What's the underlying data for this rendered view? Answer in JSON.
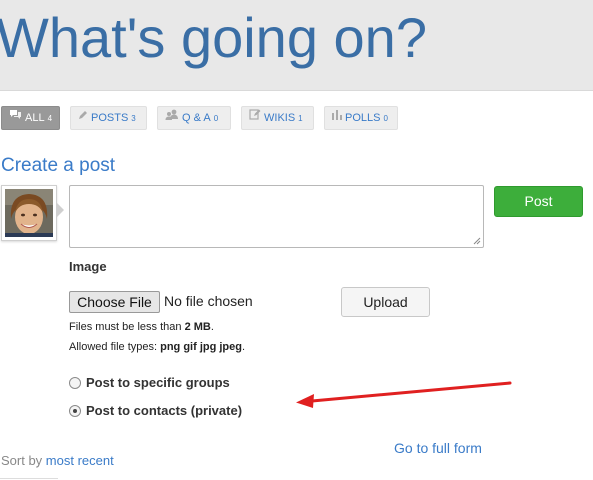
{
  "header": {
    "title": "What's going on?"
  },
  "tabs": [
    {
      "label": "ALL",
      "count": "4",
      "icon": "comments-icon",
      "active": true
    },
    {
      "label": "POSTS",
      "count": "3",
      "icon": "pencil-icon",
      "active": false
    },
    {
      "label": "Q & A",
      "count": "0",
      "icon": "users-icon",
      "active": false
    },
    {
      "label": "WIKIS",
      "count": "1",
      "icon": "edit-icon",
      "active": false
    },
    {
      "label": "POLLS",
      "count": "0",
      "icon": "bar-chart-icon",
      "active": false
    }
  ],
  "create_post": {
    "title": "Create a post",
    "textarea_value": "",
    "post_label": "Post",
    "image_label": "Image",
    "choose_file_label": "Choose File",
    "no_file_text": "No file chosen",
    "upload_label": "Upload",
    "size_text": "Files must be less than ",
    "size_value": "2 MB",
    "size_suffix": ".",
    "types_text": "Allowed file types: ",
    "types_value": "png gif jpg jpeg",
    "types_suffix": ".",
    "radio_groups_label": "Post to specific groups",
    "radio_contacts_label": "Post to contacts (private)",
    "selected_option": "contacts",
    "full_form_link": "Go to full form"
  },
  "sort": {
    "label": "Sort by ",
    "value": "most recent"
  },
  "colors": {
    "title_blue": "#3a6ea5",
    "link_blue": "#3a7bc8",
    "post_green": "#3dae3b",
    "arrow_red": "#e02020",
    "active_tab": "#999999"
  }
}
